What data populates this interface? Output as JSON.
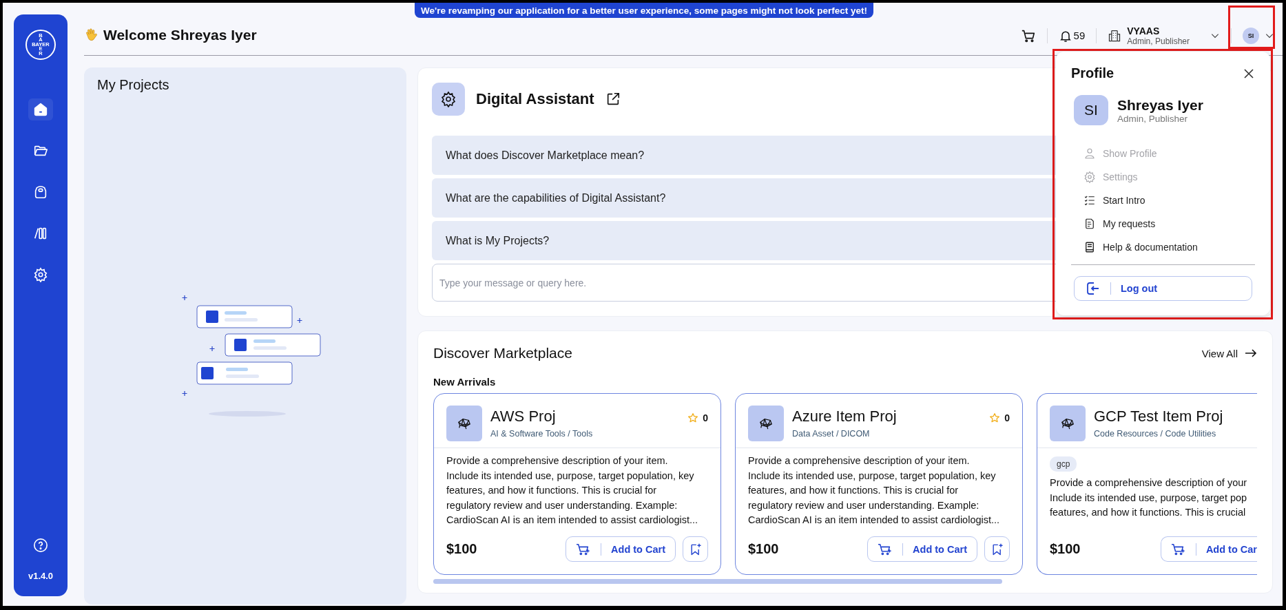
{
  "banner": "We're revamping our application for a better user experience, some pages might not look perfect yet!",
  "sidebar": {
    "logo": {
      "across": "BAYER",
      "down_top": "BA",
      "down_bottom": "ER"
    },
    "items": [
      {
        "kind": "home",
        "selected": true
      },
      {
        "kind": "folder",
        "selected": false
      },
      {
        "kind": "bag",
        "selected": false
      },
      {
        "kind": "library",
        "selected": false
      },
      {
        "kind": "settings",
        "selected": false
      }
    ],
    "version": "v1.4.0"
  },
  "header": {
    "welcome": "Welcome Shreyas Iyer",
    "notifications": "59",
    "org": {
      "name": "VYAAS",
      "roles": "Admin, Publisher"
    },
    "avatar": "SI"
  },
  "my_projects": {
    "title": "My Projects"
  },
  "assistant": {
    "title": "Digital Assistant",
    "questions": [
      "What does Discover Marketplace mean?",
      "What are the capabilities of Digital Assistant?",
      "What is My Projects?"
    ],
    "placeholder": "Type your message or query here."
  },
  "marketplace": {
    "title": "Discover Marketplace",
    "view_all": "View All",
    "section": "New Arrivals",
    "items": [
      {
        "name": "AWS Proj",
        "category": "AI & Software Tools / Tools",
        "rating": "0",
        "description": [
          "Provide a comprehensive description of your item.",
          "Include its intended use, purpose, target population, key",
          "features, and how it functions. This is crucial for",
          "regulatory review and user understanding. Example:",
          "CardioScan AI is an item intended to assist cardiologist..."
        ],
        "price": "$100",
        "add_label": "Add to Cart",
        "bookmark": true
      },
      {
        "name": "Azure Item Proj",
        "category": "Data Asset / DICOM",
        "rating": "0",
        "description": [
          "Provide a comprehensive description of your item.",
          "Include its intended use, purpose, target population, key",
          "features, and how it functions. This is crucial for",
          "regulatory review and user understanding. Example:",
          "CardioScan AI is an item intended to assist cardiologist..."
        ],
        "price": "$100",
        "add_label": "Add to Cart",
        "bookmark": true
      },
      {
        "name": "GCP Test Item Proj",
        "category": "Code Resources / Code Utilities",
        "tags": [
          "gcp"
        ],
        "description": [
          "Provide a comprehensive description of your",
          "Include its intended use, purpose, target pop",
          "features, and how it functions. This is crucial"
        ],
        "price": "$100",
        "add_label": "Add to Car"
      }
    ]
  },
  "profile": {
    "title": "Profile",
    "avatar": "SI",
    "name": "Shreyas Iyer",
    "roles": "Admin, Publisher",
    "menu": [
      {
        "kind": "person",
        "label": "Show Profile",
        "disabled": true
      },
      {
        "kind": "gear",
        "label": "Settings",
        "disabled": true
      },
      {
        "kind": "checklist",
        "label": "Start Intro",
        "disabled": false
      },
      {
        "kind": "document",
        "label": "My requests",
        "disabled": false
      },
      {
        "kind": "book",
        "label": "Help & documentation",
        "disabled": false
      }
    ],
    "logout": "Log out"
  }
}
